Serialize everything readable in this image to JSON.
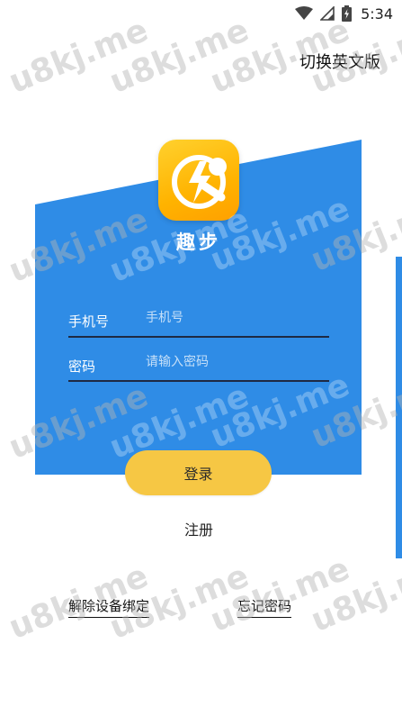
{
  "status_bar": {
    "time": "5:34",
    "icons": [
      "wifi-icon",
      "signal-icon",
      "battery-charging-icon"
    ]
  },
  "header": {
    "language_switch": "切换英文版"
  },
  "app": {
    "name": "趣步",
    "logo_icon": "app-logo-icon"
  },
  "form": {
    "phone": {
      "label": "手机号",
      "placeholder": "手机号",
      "value": ""
    },
    "password": {
      "label": "密码",
      "placeholder": "请输入密码",
      "value": ""
    }
  },
  "actions": {
    "login": "登录",
    "register": "注册",
    "unbind_device": "解除设备绑定",
    "forgot_password": "忘记密码"
  },
  "watermark": "u8kj.me",
  "colors": {
    "panel_blue": "#2f8ce6",
    "button_yellow": "#f6c744",
    "logo_orange": "#ffb300"
  }
}
